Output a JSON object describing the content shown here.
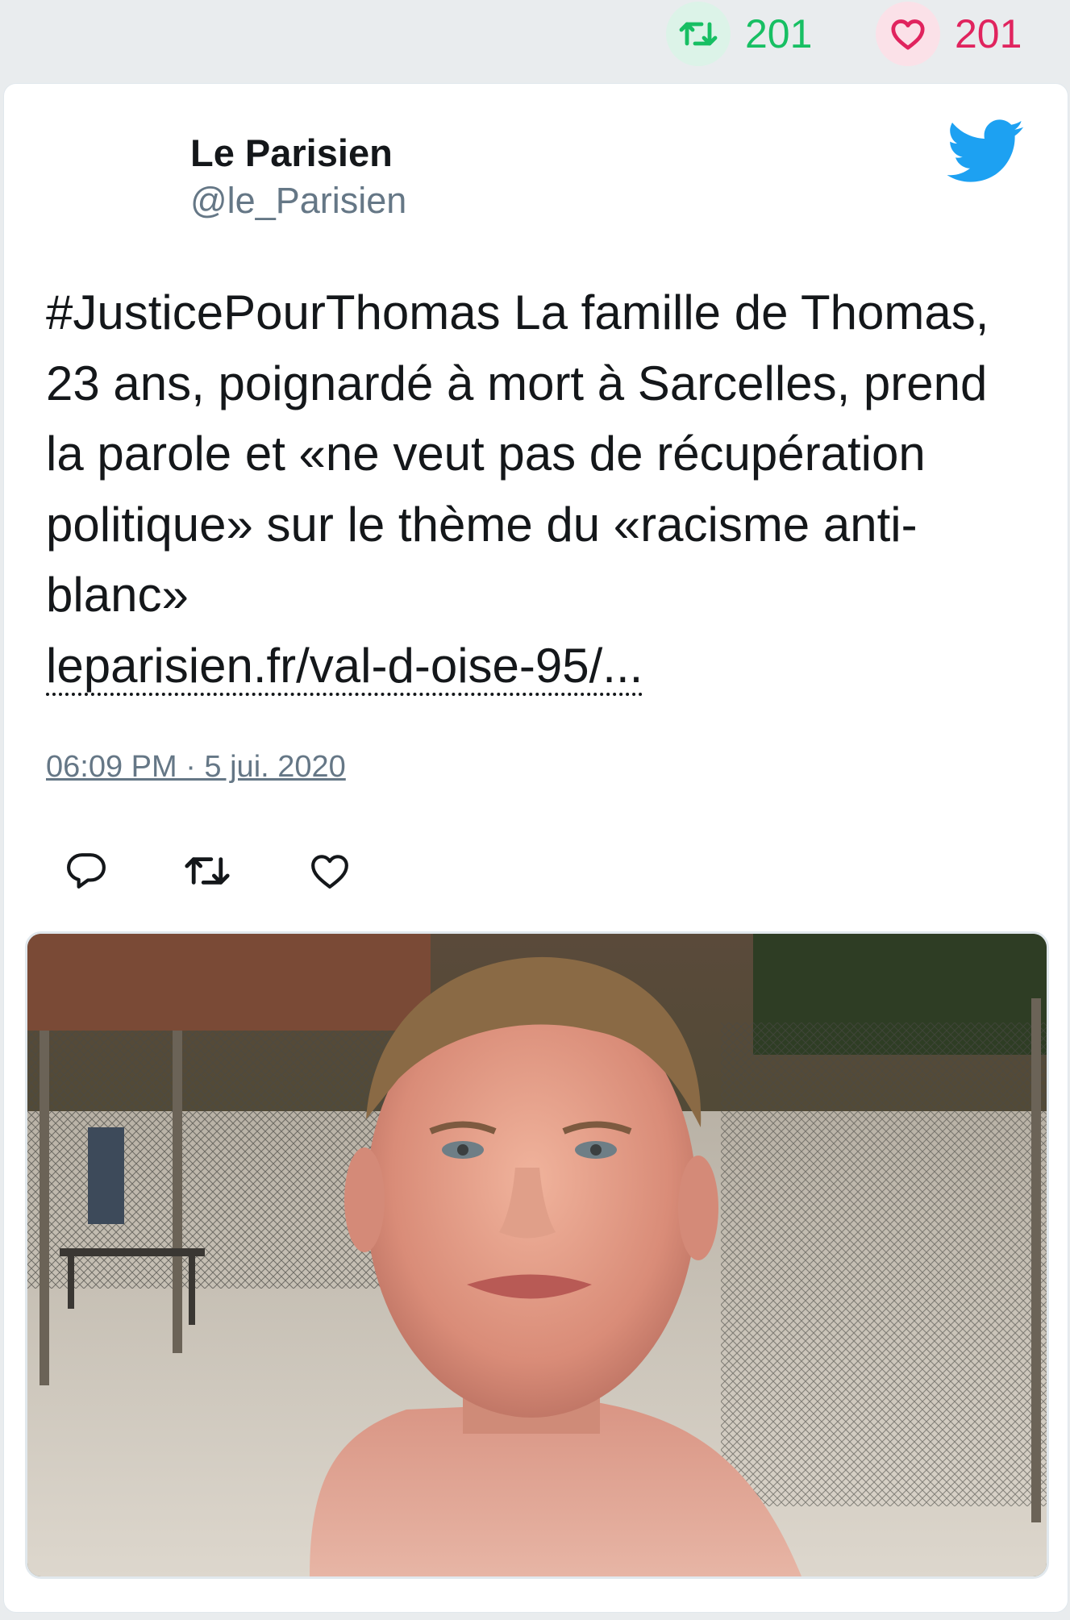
{
  "stats": {
    "retweet_count": "201",
    "like_count": "201",
    "retweet_color": "#17bf63",
    "like_color": "#e0245e"
  },
  "tweet": {
    "author_name": "Le Parisien",
    "author_handle": "@le_Parisien",
    "text": "#JusticePourThomas La famille de Thomas, 23 ans, poignardé à mort à Sarcelles, prend la parole et «ne veut pas de récupération politique» sur le thème du «racisme anti-blanc»",
    "link_text": "leparisien.fr/val-d-oise-95/...",
    "timestamp": "06:09 PM · 5 jui. 2020",
    "brand_color": "#1da1f2"
  },
  "icons": {
    "top_retweet": "retweet-icon",
    "top_like": "heart-icon",
    "logo": "twitter-bird-icon",
    "reply": "reply-icon",
    "retweet": "retweet-icon",
    "like": "heart-icon"
  }
}
